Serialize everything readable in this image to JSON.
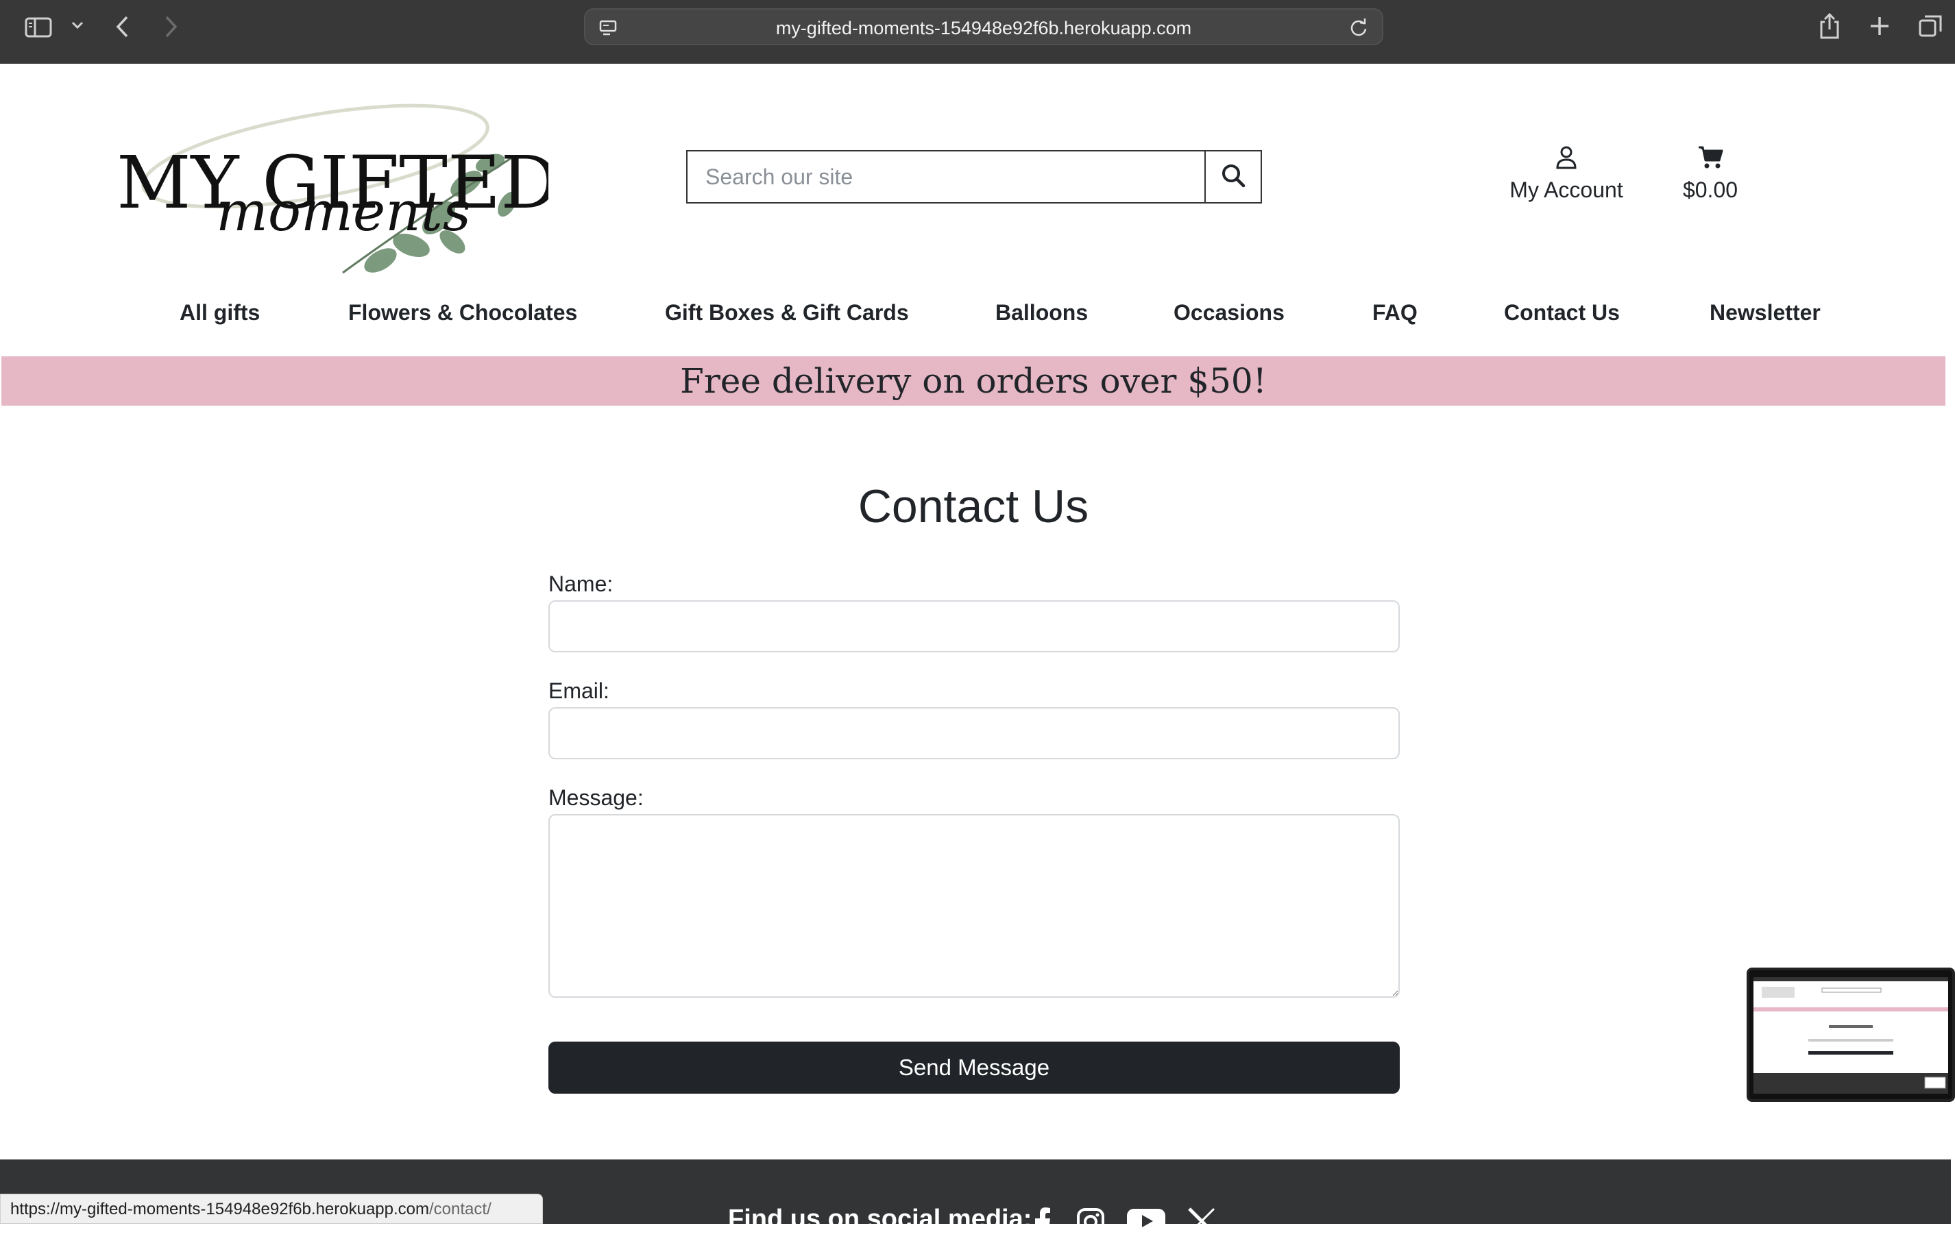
{
  "browser": {
    "url": "my-gifted-moments-154948e92f6b.herokuapp.com"
  },
  "header": {
    "logo": {
      "line1": "MY GIFTED",
      "line2": "moments"
    },
    "search": {
      "placeholder": "Search our site"
    },
    "account_label": "My Account",
    "cart_total": "$0.00"
  },
  "nav": {
    "items": [
      {
        "label": "All gifts"
      },
      {
        "label": "Flowers & Chocolates"
      },
      {
        "label": "Gift Boxes & Gift Cards"
      },
      {
        "label": "Balloons"
      },
      {
        "label": "Occasions"
      },
      {
        "label": "FAQ"
      },
      {
        "label": "Contact Us"
      },
      {
        "label": "Newsletter"
      }
    ]
  },
  "banner": {
    "text": "Free delivery on orders over $50!"
  },
  "form": {
    "title": "Contact Us",
    "name_label": "Name:",
    "email_label": "Email:",
    "message_label": "Message:",
    "name_value": "",
    "email_value": "",
    "message_value": "",
    "submit_label": "Send Message"
  },
  "footer": {
    "social_text": "Find us on social media:",
    "social_icons": [
      "facebook-icon",
      "instagram-icon",
      "youtube-icon",
      "x-icon"
    ]
  },
  "status_bar": {
    "url_main": "https://my-gifted-moments-154948e92f6b.herokuapp.com",
    "url_path": "/contact/"
  },
  "colors": {
    "chrome_bg": "#383838",
    "banner_bg": "#e6b8c6",
    "button_bg": "#212529",
    "footer_bg": "#333435"
  }
}
